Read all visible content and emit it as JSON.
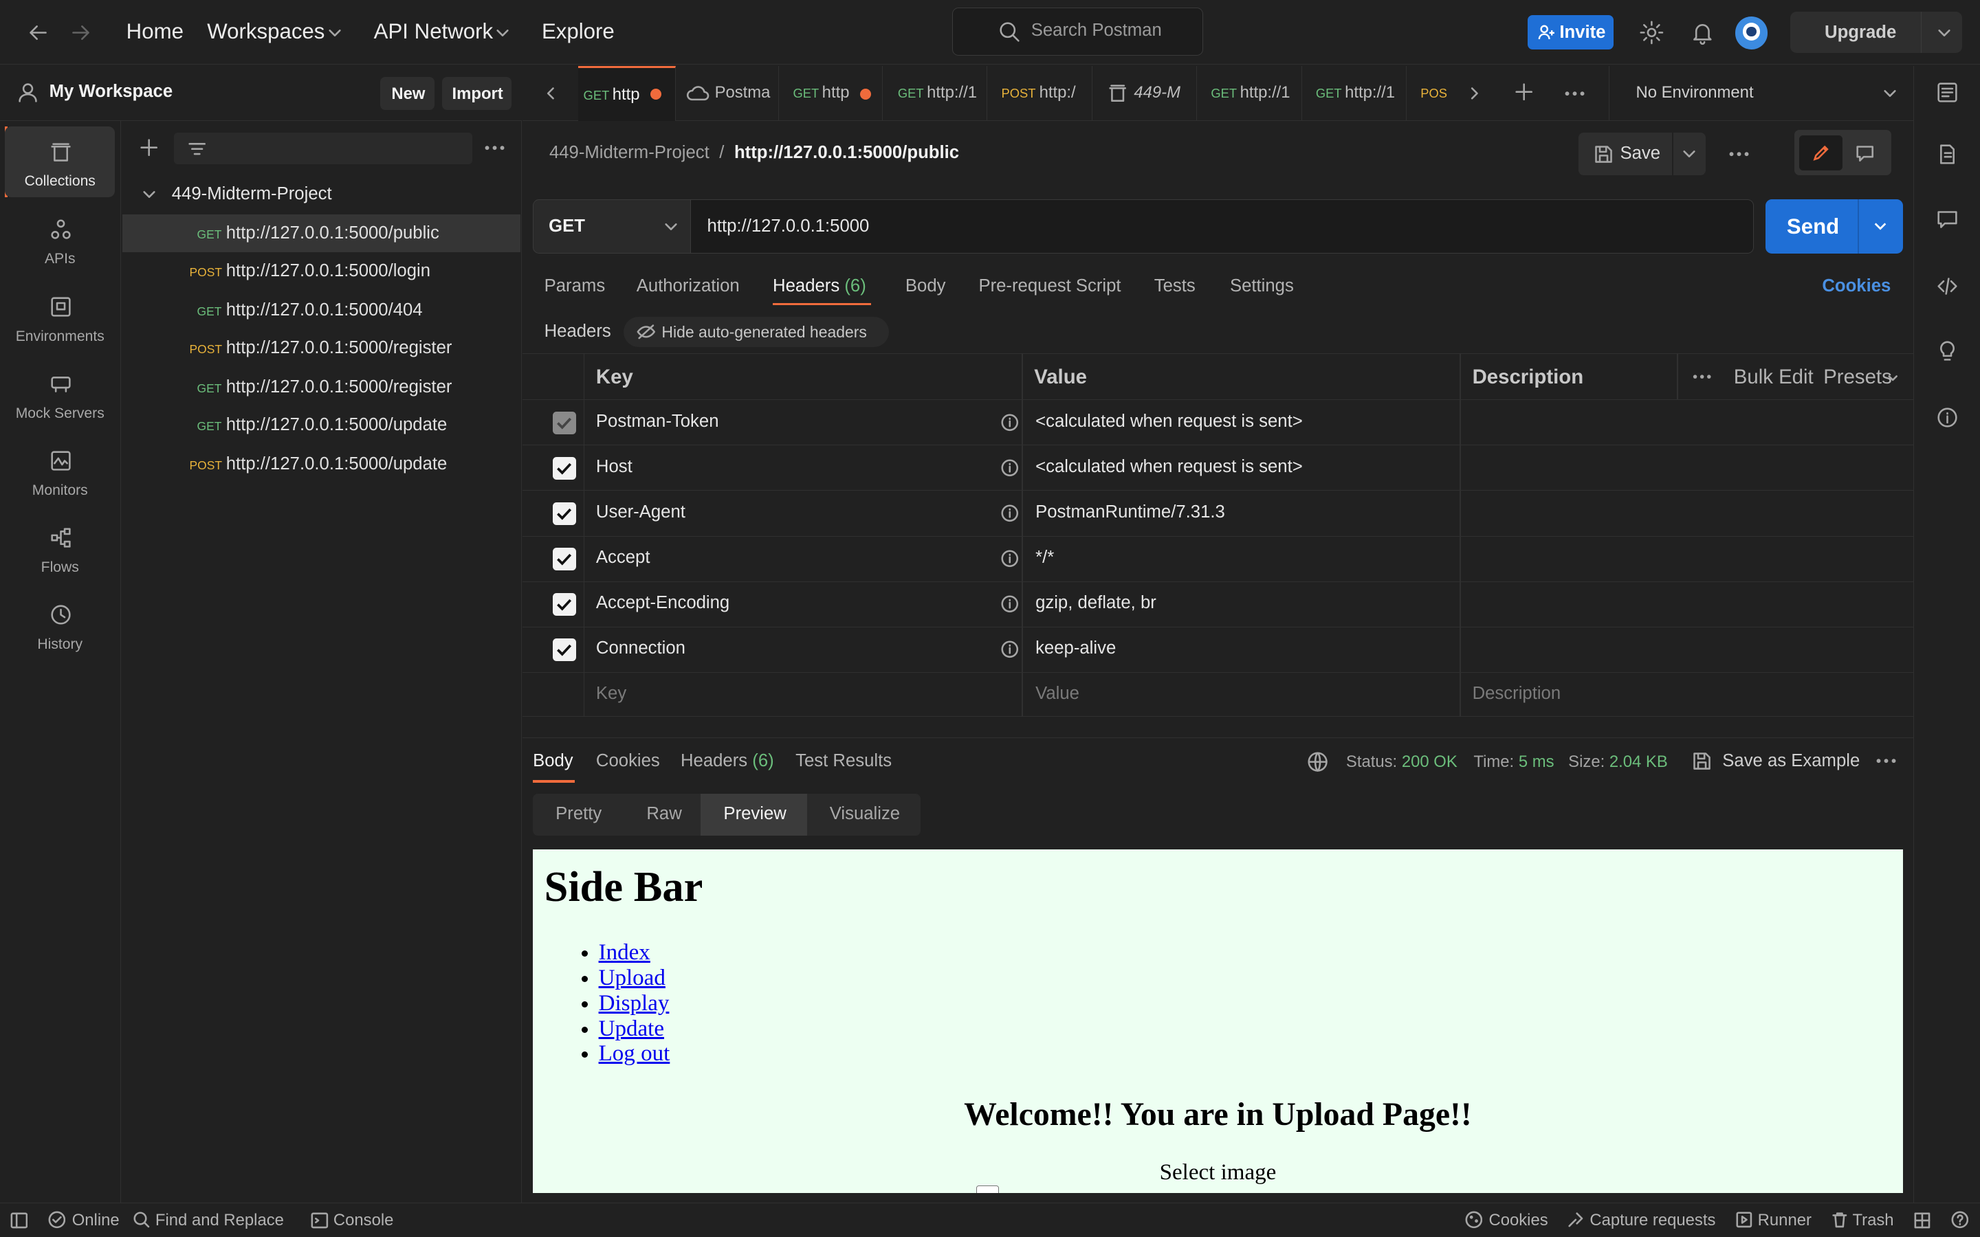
{
  "topbar": {
    "nav": {
      "home": "Home",
      "workspaces": "Workspaces",
      "api_network": "API Network",
      "explore": "Explore"
    },
    "search_placeholder": "Search Postman",
    "invite": "Invite",
    "upgrade": "Upgrade"
  },
  "workspace": {
    "name": "My Workspace",
    "new": "New",
    "import": "Import"
  },
  "rail": [
    {
      "label": "Collections",
      "icon": "collections-icon"
    },
    {
      "label": "APIs",
      "icon": "apis-icon"
    },
    {
      "label": "Environments",
      "icon": "environments-icon"
    },
    {
      "label": "Mock Servers",
      "icon": "mock-servers-icon"
    },
    {
      "label": "Monitors",
      "icon": "monitors-icon"
    },
    {
      "label": "Flows",
      "icon": "flows-icon"
    },
    {
      "label": "History",
      "icon": "history-icon"
    }
  ],
  "collection": {
    "name": "449-Midterm-Project",
    "requests": [
      {
        "method": "GET",
        "url": "http://127.0.0.1:5000/public"
      },
      {
        "method": "POST",
        "url": "http://127.0.0.1:5000/login"
      },
      {
        "method": "GET",
        "url": "http://127.0.0.1:5000/404"
      },
      {
        "method": "POST",
        "url": "http://127.0.0.1:5000/register"
      },
      {
        "method": "GET",
        "url": "http://127.0.0.1:5000/register"
      },
      {
        "method": "GET",
        "url": "http://127.0.0.1:5000/update"
      },
      {
        "method": "POST",
        "url": "http://127.0.0.1:5000/update"
      }
    ]
  },
  "tabs": [
    {
      "method": "GET",
      "title": "http"
    },
    {
      "method": "",
      "title": "Postma"
    },
    {
      "method": "GET",
      "title": "http"
    },
    {
      "method": "GET",
      "title": "http://1"
    },
    {
      "method": "POST",
      "title": "http:/"
    },
    {
      "method": "",
      "title": "449-M"
    },
    {
      "method": "GET",
      "title": "http://1"
    },
    {
      "method": "GET",
      "title": "http://1"
    },
    {
      "method": "POST",
      "title": ""
    }
  ],
  "environment": "No Environment",
  "request": {
    "breadcrumb_collection": "449-Midterm-Project",
    "breadcrumb_sep": "/",
    "breadcrumb_request": "http://127.0.0.1:5000/public",
    "save": "Save",
    "method": "GET",
    "url": "http://127.0.0.1:5000",
    "send": "Send",
    "tabs": {
      "params": "Params",
      "authorization": "Authorization",
      "headers": "Headers",
      "headers_count": "(6)",
      "body": "Body",
      "prerequest": "Pre-request Script",
      "tests": "Tests",
      "settings": "Settings"
    },
    "cookies": "Cookies",
    "headers_label": "Headers",
    "hide_auto": "Hide auto-generated headers"
  },
  "headers_table": {
    "columns": {
      "key": "Key",
      "value": "Value",
      "description": "Description"
    },
    "bulk_edit": "Bulk Edit",
    "presets": "Presets",
    "rows": [
      {
        "key": "Postman-Token",
        "value": "<calculated when request is sent>"
      },
      {
        "key": "Host",
        "value": "<calculated when request is sent>"
      },
      {
        "key": "User-Agent",
        "value": "PostmanRuntime/7.31.3"
      },
      {
        "key": "Accept",
        "value": "*/*"
      },
      {
        "key": "Accept-Encoding",
        "value": "gzip, deflate, br"
      },
      {
        "key": "Connection",
        "value": "keep-alive"
      }
    ],
    "placeholder": {
      "key": "Key",
      "value": "Value",
      "description": "Description"
    }
  },
  "response": {
    "tabs": {
      "body": "Body",
      "cookies": "Cookies",
      "headers": "Headers",
      "headers_count": "(6)",
      "test_results": "Test Results"
    },
    "status_label": "Status:",
    "status": "200 OK",
    "time_label": "Time:",
    "time": "5 ms",
    "size_label": "Size:",
    "size": "2.04 KB",
    "save_example": "Save as Example",
    "views": {
      "pretty": "Pretty",
      "raw": "Raw",
      "preview": "Preview",
      "visualize": "Visualize"
    }
  },
  "preview": {
    "heading": "Side Bar",
    "links": [
      "Index",
      "Upload",
      "Display",
      "Update",
      "Log out"
    ],
    "welcome": "Welcome!! You are in Upload Page!!",
    "select": "Select image"
  },
  "footer": {
    "online": "Online",
    "find_replace": "Find and Replace",
    "console": "Console",
    "cookies": "Cookies",
    "capture": "Capture requests",
    "runner": "Runner",
    "trash": "Trash"
  },
  "colors": {
    "accent": "#f06b3c",
    "primary": "#1f6fd6",
    "get": "#6bbd7b",
    "post": "#e8b23a"
  }
}
